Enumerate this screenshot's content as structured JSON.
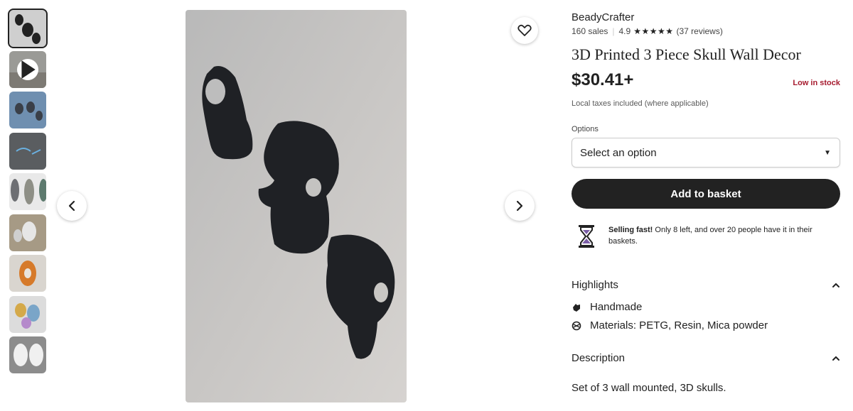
{
  "listing": {
    "shop_name": "BeadyCrafter",
    "sales": "160 sales",
    "rating": "4.9",
    "stars": "★★★★★",
    "reviews": "(37 reviews)",
    "title": "3D Printed 3 Piece Skull Wall Decor",
    "price": "$30.41+",
    "stock_status": "Low in stock",
    "tax_note": "Local taxes included (where applicable)"
  },
  "options": {
    "label": "Options",
    "selected": "Select an option"
  },
  "actions": {
    "add_label": "Add to basket"
  },
  "scarcity": {
    "bold": "Selling fast!",
    "text": " Only 8 left, and over 20 people have it in their baskets."
  },
  "highlights": {
    "heading": "Highlights",
    "items": [
      "Handmade",
      "Materials: PETG, Resin, Mica powder"
    ]
  },
  "description": {
    "heading": "Description",
    "text": "Set of 3 wall mounted, 3D skulls."
  },
  "icons": [
    "heart-icon",
    "chevron-left-icon",
    "chevron-right-icon",
    "play-icon",
    "hourglass-icon",
    "caret-down-icon",
    "chevron-up-icon",
    "hand-icon",
    "materials-icon"
  ],
  "colors": {
    "stock": "#a61a2e",
    "button": "#222222",
    "hourglass": "#7b5ea7"
  }
}
